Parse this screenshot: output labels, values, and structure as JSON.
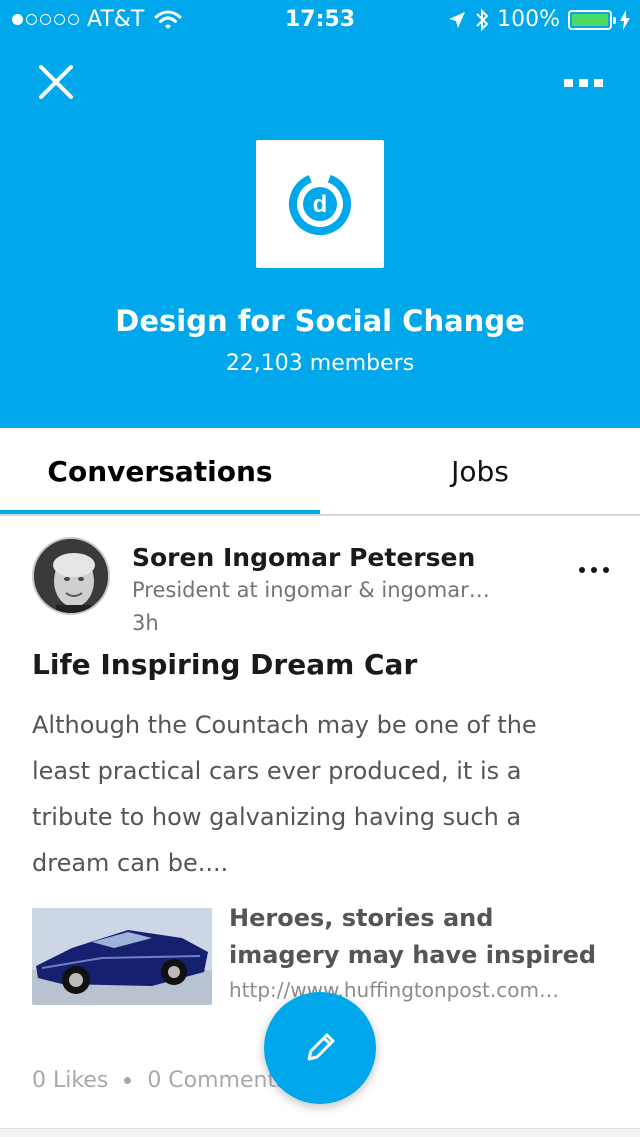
{
  "status_bar": {
    "carrier": "AT&T",
    "time": "17:53",
    "battery": "100%",
    "signal_bars_filled": 1,
    "signal_bars_total": 5,
    "battery_level": 1.0
  },
  "header": {
    "group_name": "Design for Social Change",
    "member_count": "22,103 members",
    "logo_letter": "d",
    "icons": [
      "close-icon",
      "more-icon"
    ],
    "background_color": "#00A8EB"
  },
  "tabs": [
    {
      "label": "Conversations",
      "active": true
    },
    {
      "label": "Jobs",
      "active": false
    }
  ],
  "post": {
    "author": "Soren Ingomar Petersen",
    "headline": "President at ingomar & ingomar…",
    "time": "3h",
    "title": "Life Inspiring Dream Car",
    "body": "Although the Countach may be one of the least practical cars ever produced, it is a tribute to how galvanizing having such a dream can be....",
    "link": {
      "title": "Heroes, stories and imagery may have inspired humans…",
      "url": "http://www.huffingtonpost.com…"
    },
    "likes": "0 Likes",
    "comments": "0 Comments"
  },
  "fab": {
    "icon": "pencil-icon"
  },
  "colors": {
    "accent": "#00A8EB",
    "battery": "#4cd964"
  }
}
